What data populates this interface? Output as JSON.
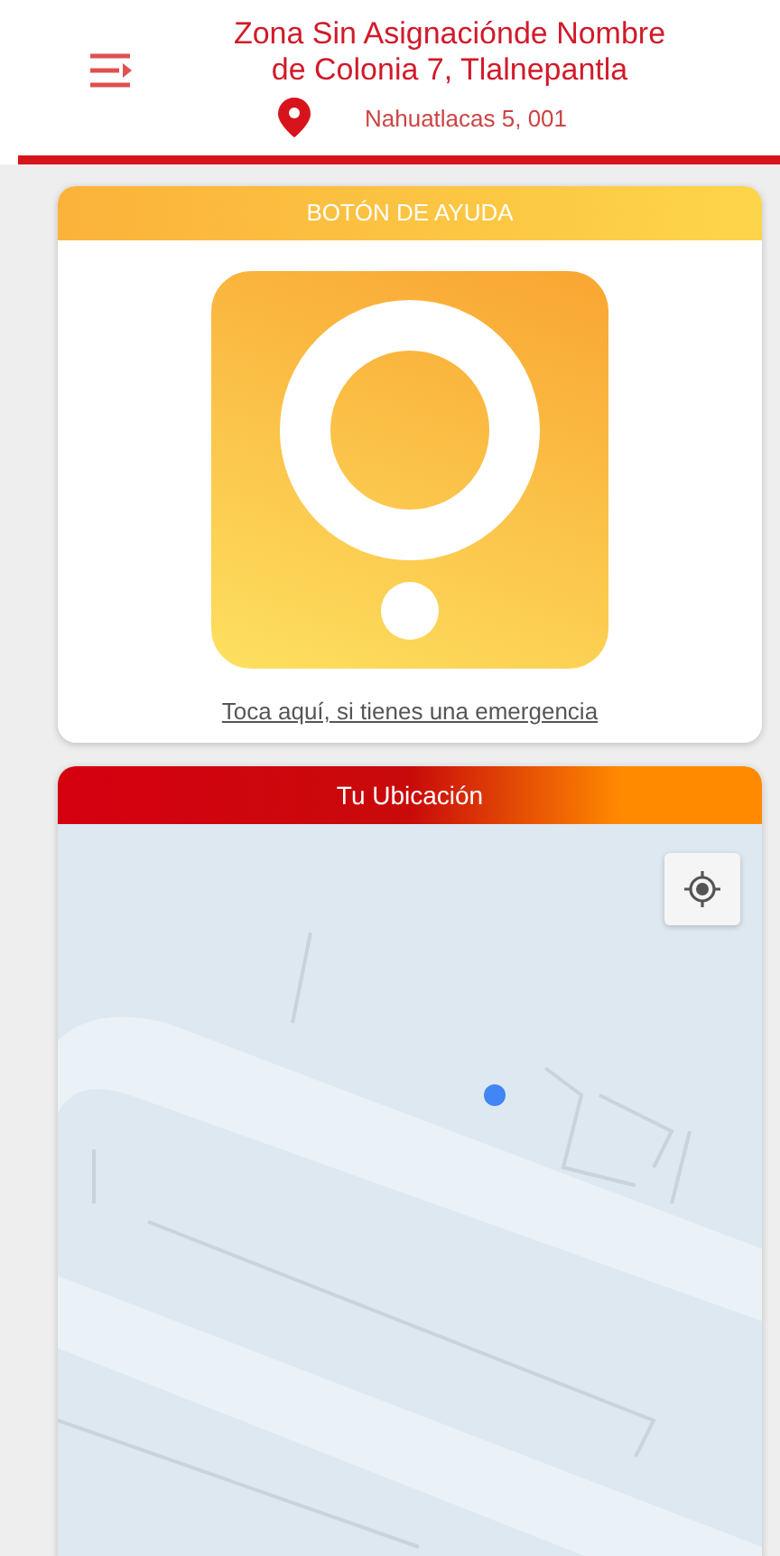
{
  "header": {
    "title": "Zona Sin Asignaciónde Nombre de Colonia 7, Tlalnepantla",
    "address": "Nahuatlacas 5, 001"
  },
  "help_card": {
    "title": "BOTÓN DE AYUDA",
    "link": "Toca aquí, si tienes una emergencia"
  },
  "location_card": {
    "title": "Tu Ubicación"
  }
}
